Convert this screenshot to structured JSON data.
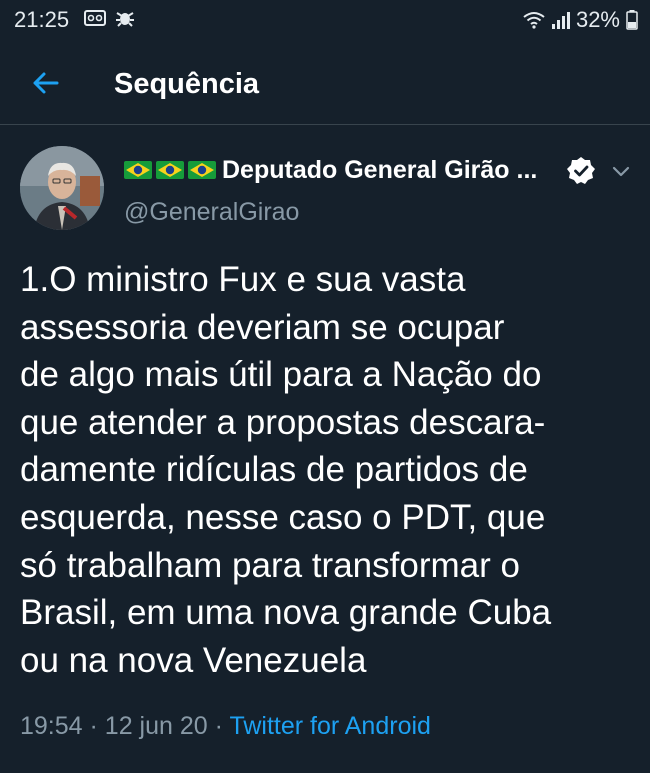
{
  "status_bar": {
    "time": "21:25",
    "battery": "32%",
    "icons": [
      "voicemail-icon",
      "bug-icon",
      "wifi-icon",
      "signal-icon",
      "battery-icon"
    ]
  },
  "header": {
    "title": "Sequência",
    "back_icon": "arrow-left-icon"
  },
  "tweet": {
    "author_name": "Deputado General Girão ...",
    "handle": "@GeneralGirao",
    "text_lines": [
      "1.O ministro Fux e sua vasta",
      "assessoria deveriam se ocupar",
      "de algo mais útil para a Nação do",
      "que atender a propostas descara-",
      "damente ridículas de partidos de",
      "esquerda, nesse caso o PDT, que",
      "só trabalham para transformar o",
      "Brasil, em uma nova grande Cuba",
      "ou na nova Venezuela"
    ],
    "time": "19:54",
    "separator": "·",
    "date": "12 jun 20",
    "source": "Twitter for Android"
  },
  "colors": {
    "background": "#15202b",
    "secondary_text": "#8899a6",
    "accent": "#1da1f2",
    "divider": "#38444d"
  }
}
